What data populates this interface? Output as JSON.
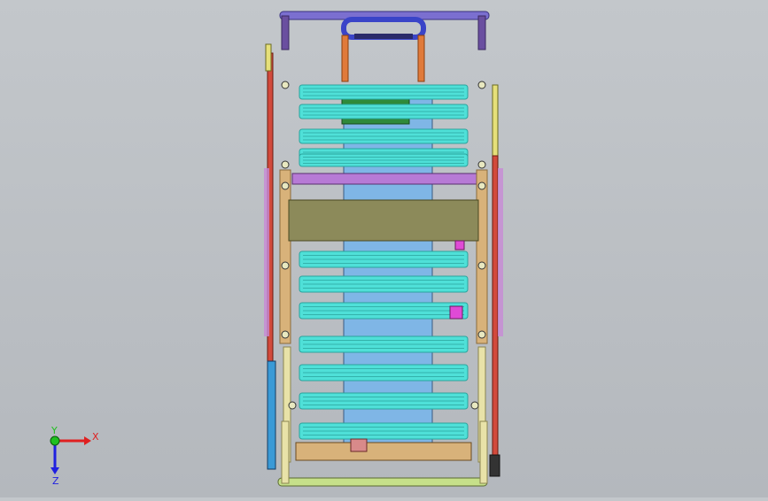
{
  "viewport": {
    "background_top": "#c3c7cb",
    "background_bottom": "#b4b8bd"
  },
  "model": {
    "colors": {
      "handle_bar": "#7b6fd0",
      "handle_grip": "#3a44c8",
      "orange_post": "#e07a3a",
      "tread": "#4fe0d8",
      "tread_dark": "#2aa39d",
      "tread_green": "#39c24a",
      "frame_tan": "#d8b27a",
      "frame_tan_dark": "#8a6a3a",
      "olive_plate": "#8c8a5a",
      "inner_blue": "#7fb6e6",
      "purple_rail": "#b77ad6",
      "red_rod": "#d24a3c",
      "yellow_rod": "#e6e07a",
      "blue_rod": "#3a9ad6",
      "magenta": "#e04ad6",
      "base_green": "#c6e08a"
    }
  },
  "triad": {
    "x_label": "X",
    "y_label": "Y",
    "z_label": "Z",
    "x_color": "#e02020",
    "y_color": "#20c020",
    "z_color": "#2020e0"
  }
}
